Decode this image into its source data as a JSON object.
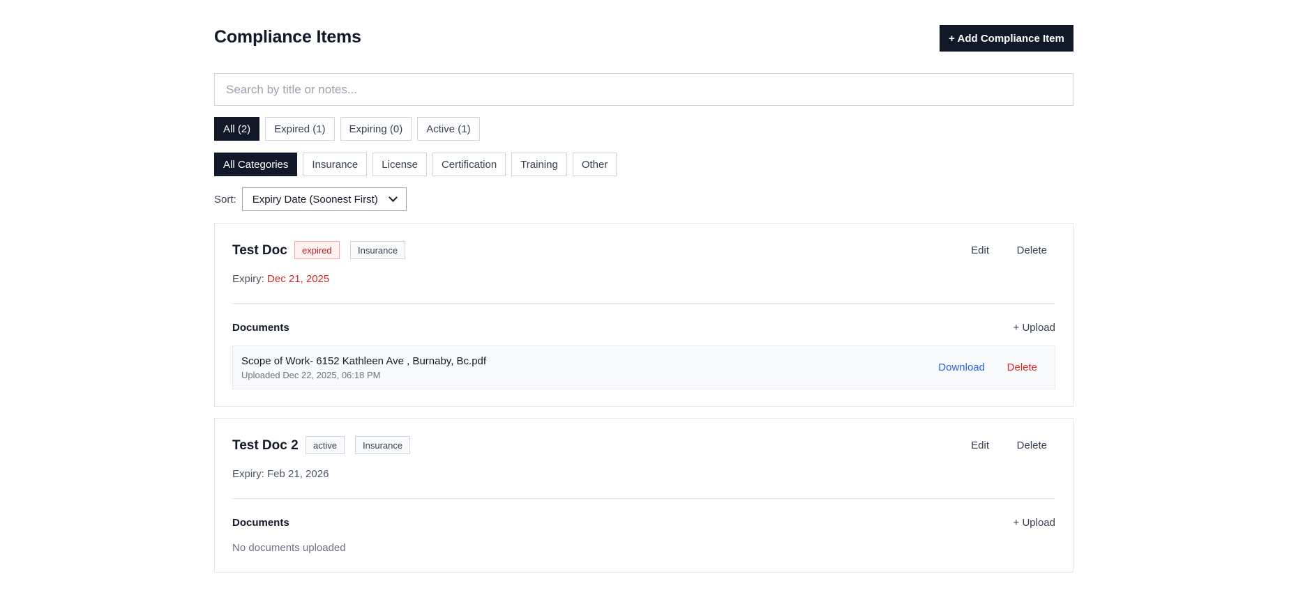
{
  "header": {
    "title": "Compliance Items",
    "add_button": "+ Add Compliance Item"
  },
  "search": {
    "placeholder": "Search by title or notes...",
    "value": ""
  },
  "status_filters": [
    {
      "label": "All (2)",
      "active": true
    },
    {
      "label": "Expired (1)",
      "active": false
    },
    {
      "label": "Expiring (0)",
      "active": false
    },
    {
      "label": "Active (1)",
      "active": false
    }
  ],
  "category_filters": [
    {
      "label": "All Categories",
      "active": true
    },
    {
      "label": "Insurance",
      "active": false
    },
    {
      "label": "License",
      "active": false
    },
    {
      "label": "Certification",
      "active": false
    },
    {
      "label": "Training",
      "active": false
    },
    {
      "label": "Other",
      "active": false
    }
  ],
  "sort": {
    "label": "Sort:",
    "selected": "Expiry Date (Soonest First)"
  },
  "items": [
    {
      "title": "Test Doc",
      "status": "expired",
      "category": "Insurance",
      "edit_label": "Edit",
      "delete_label": "Delete",
      "expiry_label": "Expiry:",
      "expiry_date": "Dec 21, 2025",
      "documents_label": "Documents",
      "upload_label": "+ Upload",
      "documents": [
        {
          "name": "Scope of Work- 6152 Kathleen Ave , Burnaby, Bc.pdf",
          "uploaded": "Uploaded Dec 22, 2025, 06:18 PM",
          "download_label": "Download",
          "delete_label": "Delete"
        }
      ]
    },
    {
      "title": "Test Doc 2",
      "status": "active",
      "category": "Insurance",
      "edit_label": "Edit",
      "delete_label": "Delete",
      "expiry_label": "Expiry:",
      "expiry_date": "Feb 21, 2026",
      "documents_label": "Documents",
      "upload_label": "+ Upload",
      "empty_text": "No documents uploaded"
    }
  ],
  "colors": {
    "primary": "#111827",
    "danger": "#dc2626",
    "link": "#2563eb",
    "border": "#e5e7eb"
  }
}
